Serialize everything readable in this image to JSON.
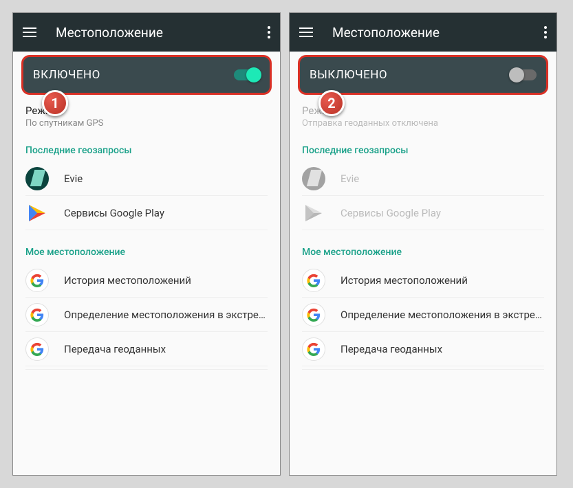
{
  "screens": [
    {
      "badge": "1",
      "title": "Местоположение",
      "toggle": {
        "label": "ВКЛЮЧЕНО",
        "state": "on"
      },
      "mode": {
        "title": "Режим",
        "subtitle": "По спутникам GPS",
        "disabled": false
      },
      "recent": {
        "header": "Последние геозапросы",
        "items": [
          {
            "label": "Evie",
            "icon": "evie",
            "dim": false
          },
          {
            "label": "Сервисы Google Play",
            "icon": "play",
            "dim": false
          }
        ]
      },
      "location": {
        "header": "Мое местоположение",
        "items": [
          {
            "label": "История местоположений",
            "icon": "google"
          },
          {
            "label": "Определение местоположения в экстрен..",
            "icon": "google"
          },
          {
            "label": "Передача геоданных",
            "icon": "google"
          }
        ]
      }
    },
    {
      "badge": "2",
      "title": "Местоположение",
      "toggle": {
        "label": "ВЫКЛЮЧЕНО",
        "state": "off"
      },
      "mode": {
        "title": "Режим",
        "subtitle": "Отправка геоданных отключена",
        "disabled": true
      },
      "recent": {
        "header": "Последние геозапросы",
        "items": [
          {
            "label": "Evie",
            "icon": "evie",
            "dim": true
          },
          {
            "label": "Сервисы Google Play",
            "icon": "play",
            "dim": true
          }
        ]
      },
      "location": {
        "header": "Мое местоположение",
        "items": [
          {
            "label": "История местоположений",
            "icon": "google"
          },
          {
            "label": "Определение местоположения в экстрен..",
            "icon": "google"
          },
          {
            "label": "Передача геоданных",
            "icon": "google"
          }
        ]
      }
    }
  ]
}
